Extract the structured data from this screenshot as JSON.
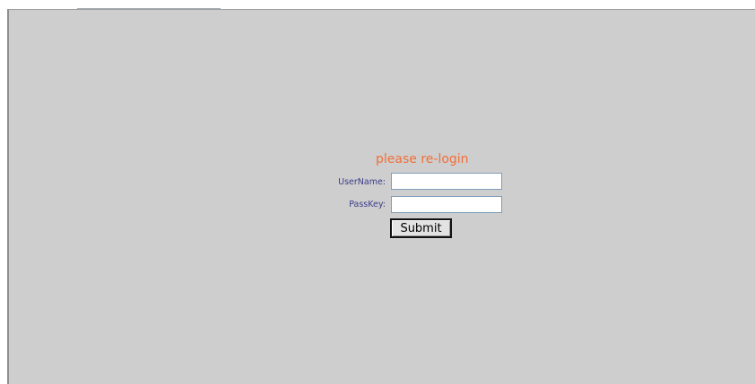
{
  "login": {
    "title": "please re-login",
    "username_label": "UserName:",
    "username_value": "",
    "passkey_label": "PassKey:",
    "passkey_value": "",
    "submit_label": "Submit"
  },
  "colors": {
    "background": "#cecece",
    "title": "#f0703a",
    "label": "#3a3c8a"
  }
}
